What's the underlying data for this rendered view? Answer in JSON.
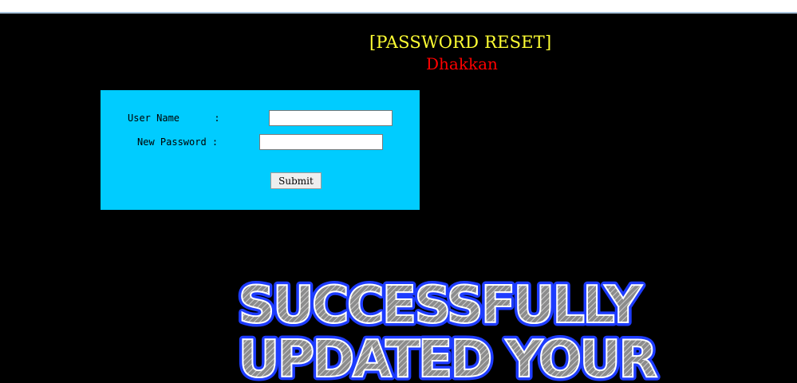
{
  "page": {
    "heading": "[PASSWORD RESET]",
    "subheading": "Dhakkan"
  },
  "form": {
    "username_label": "User Name      :",
    "username_value": "",
    "password_label": "New Password :",
    "password_value": "",
    "submit_label": "Submit"
  },
  "banner": {
    "line1": "SUCCESSFULLY",
    "line2": "UPDATED YOUR",
    "text_color": "#9a9a9a",
    "glow_color": "#1e3cff"
  },
  "colors": {
    "background": "#000000",
    "heading": "#ffff33",
    "subheading": "#ff0000",
    "panel": "#00ccff"
  }
}
